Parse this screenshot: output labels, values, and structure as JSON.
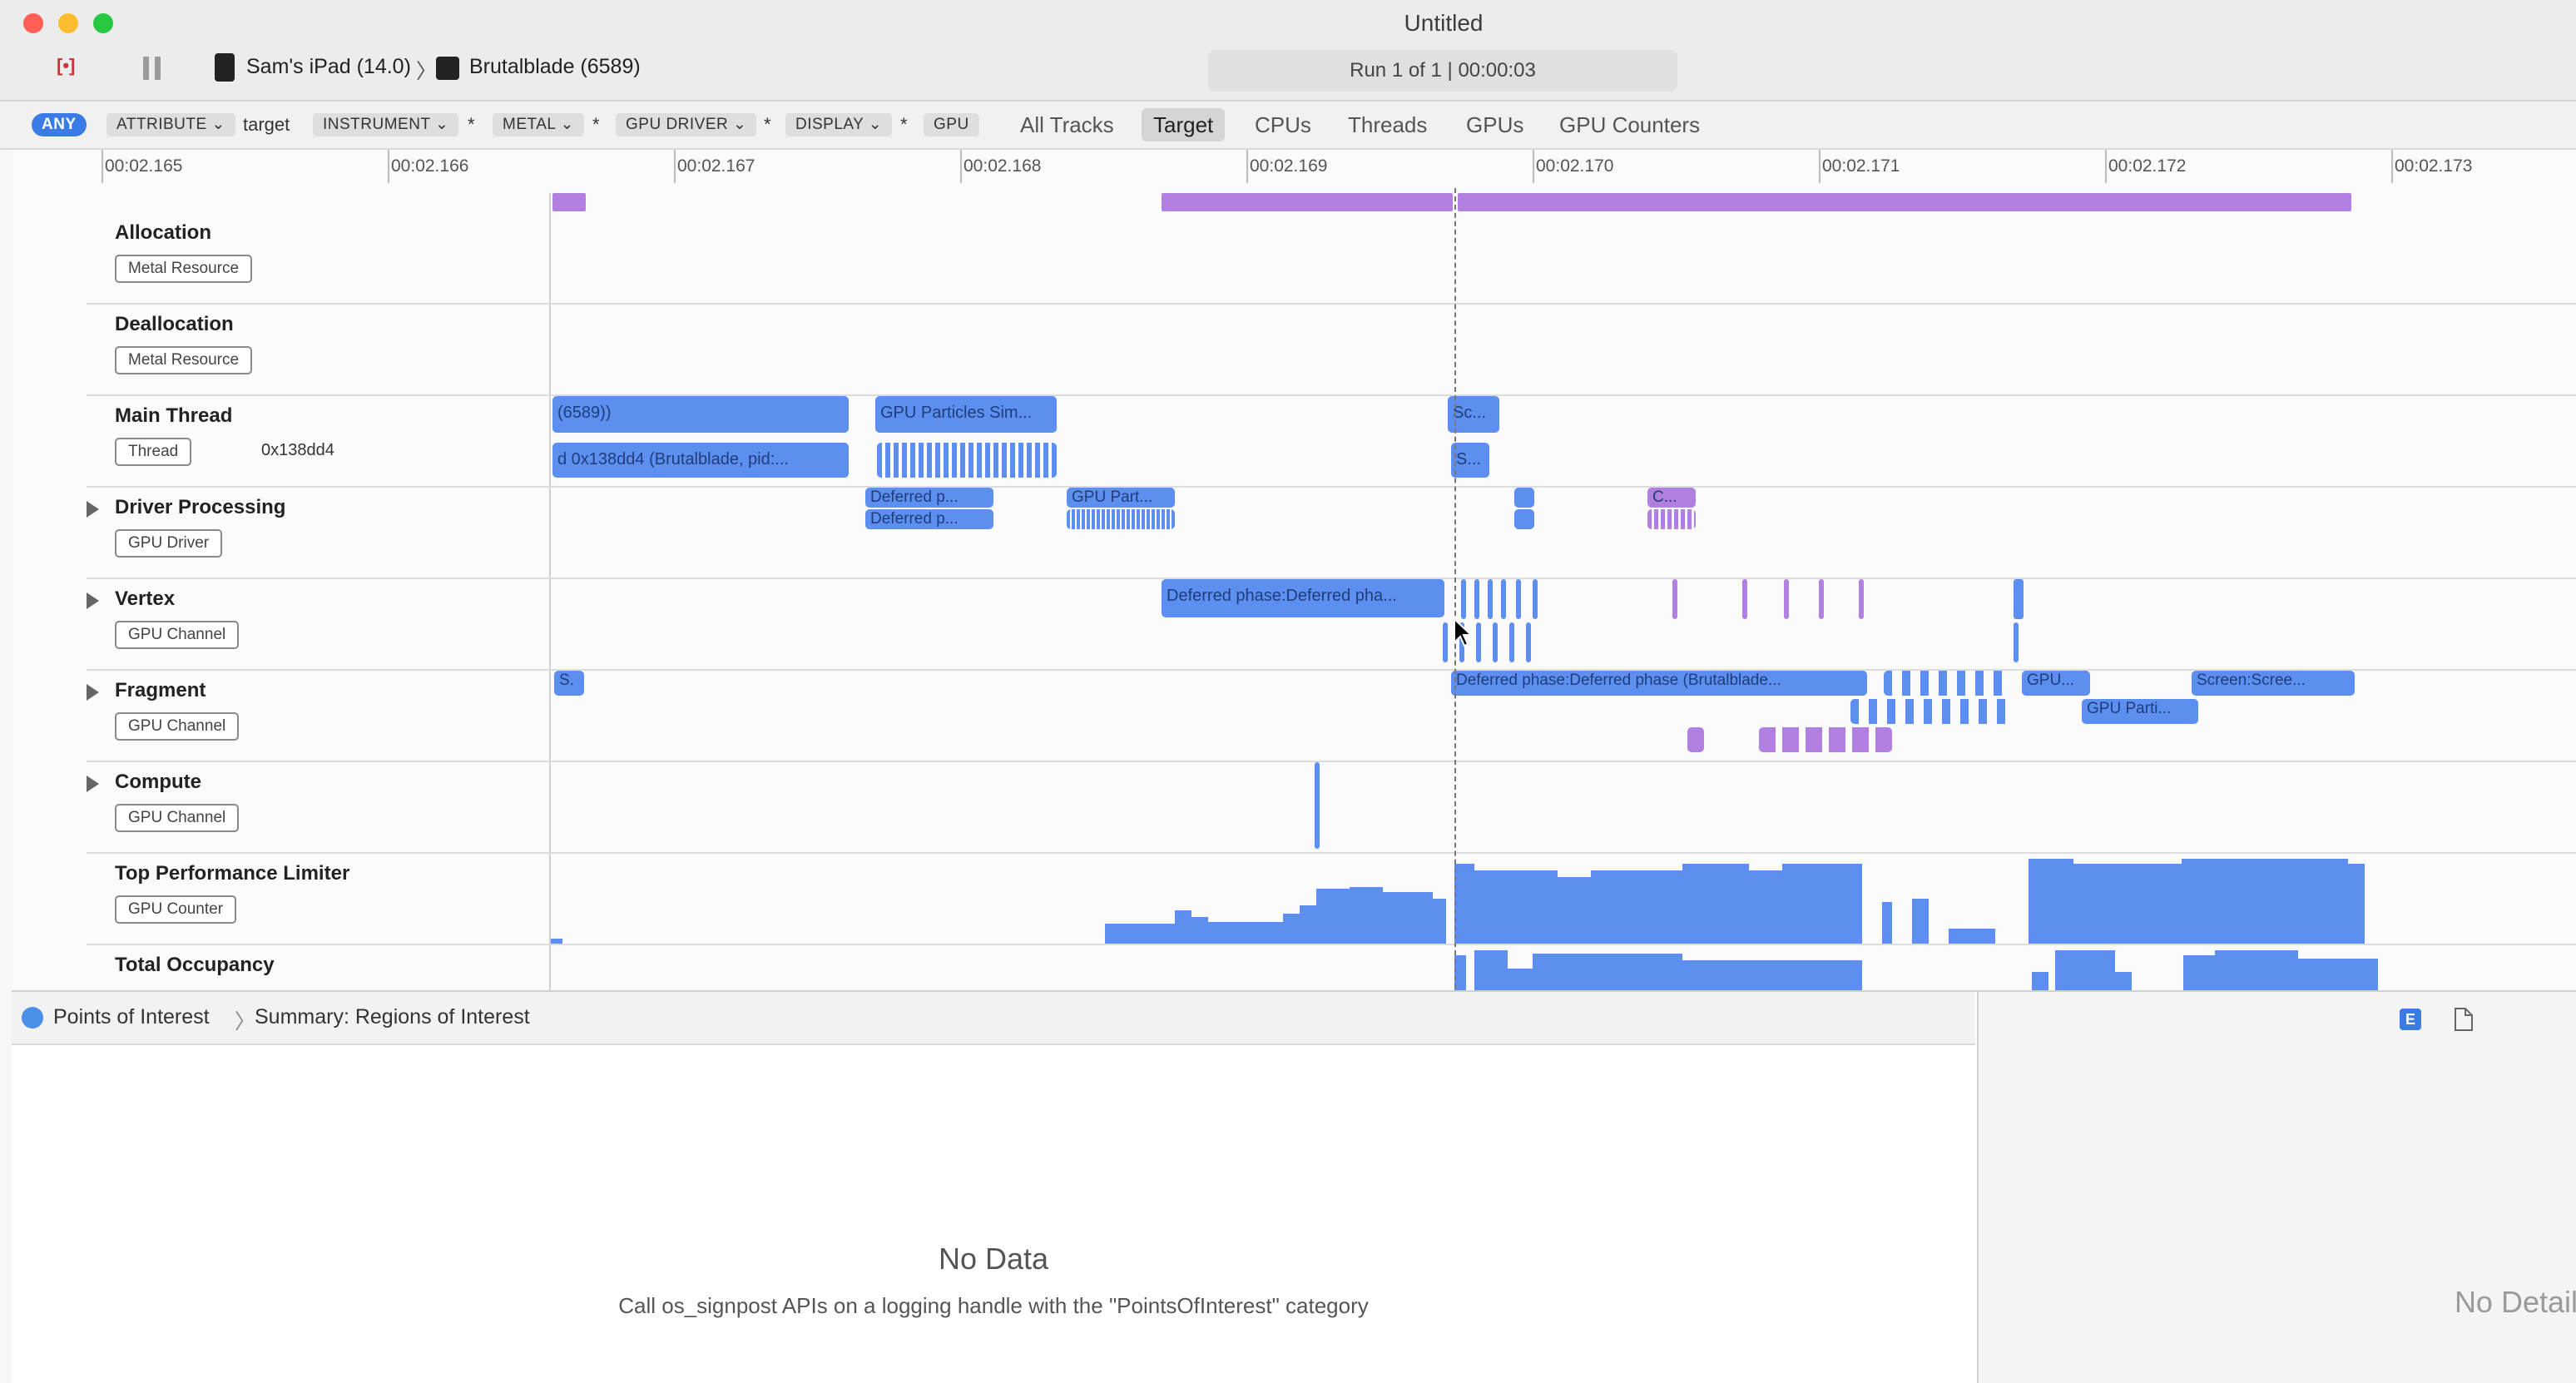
{
  "window": {
    "title": "Untitled",
    "device": "Sam's iPad (14.0)",
    "process": "Brutalblade (6589)",
    "run_status": "Run 1 of 1  |  00:00:03",
    "traffic_colors": [
      "#ff5f57",
      "#febc2e",
      "#28c840"
    ]
  },
  "toolbar": {
    "record_label": "[•]",
    "filters": {
      "any": "ANY",
      "attribute": "ATTRIBUTE ⌄",
      "target": "target",
      "instrument": "INSTRUMENT ⌄",
      "star1": "*",
      "metal": "METAL ⌄",
      "star2": "*",
      "gpu_driver": "GPU DRIVER ⌄",
      "star3": "*",
      "display": "DISPLAY ⌄",
      "star4": "*",
      "gpu": "GPU"
    },
    "tabs": [
      "All Tracks",
      "Target",
      "CPUs",
      "Threads",
      "GPUs",
      "GPU Counters"
    ],
    "active_tab": "Target"
  },
  "ruler": {
    "ticks": [
      "00:02.165",
      "00:02.166",
      "00:02.167",
      "00:02.168",
      "00:02.169",
      "00:02.170",
      "00:02.171",
      "00:02.172",
      "00:02.173"
    ]
  },
  "tracks": [
    {
      "title": "Allocation",
      "badge": "Metal Resource"
    },
    {
      "title": "Deallocation",
      "badge": "Metal Resource"
    },
    {
      "title": "Main Thread",
      "badge": "Thread",
      "extra": "0x138dd4"
    },
    {
      "title": "Driver Processing",
      "badge": "GPU Driver"
    },
    {
      "title": "Vertex",
      "badge": "GPU Channel"
    },
    {
      "title": "Fragment",
      "badge": "GPU Channel"
    },
    {
      "title": "Compute",
      "badge": "GPU Channel"
    },
    {
      "title": "Top Performance Limiter",
      "badge": "GPU Counter"
    },
    {
      "title": "Total Occupancy",
      "badge": ""
    }
  ],
  "bars": {
    "main_1": "(6589))",
    "main_2": "GPU Particles Sim...",
    "main_3": "Sc...",
    "main_4": "d  0x138dd4 (Brutalblade, pid:...",
    "main_5": "S...",
    "drv_1": "Deferred p...",
    "drv_2": "Deferred p...",
    "drv_3": "GPU Part...",
    "drv_4": "C...",
    "vtx_1": "Deferred phase:Deferred pha...",
    "frg_1": "S.",
    "frg_2": "Deferred phase:Deferred phase (Brutalblade...",
    "frg_3": "GPU...",
    "frg_4": "Screen:Scree...",
    "frg_5": "GPU Parti..."
  },
  "bottom": {
    "breadcrumb_root": "Points of Interest",
    "breadcrumb_child": "Summary: Regions of Interest",
    "empty_title": "No Data",
    "empty_desc": "Call os_signpost APIs on a logging handle with the \"PointsOfInterest\" category",
    "detail_empty": "No Detail"
  }
}
